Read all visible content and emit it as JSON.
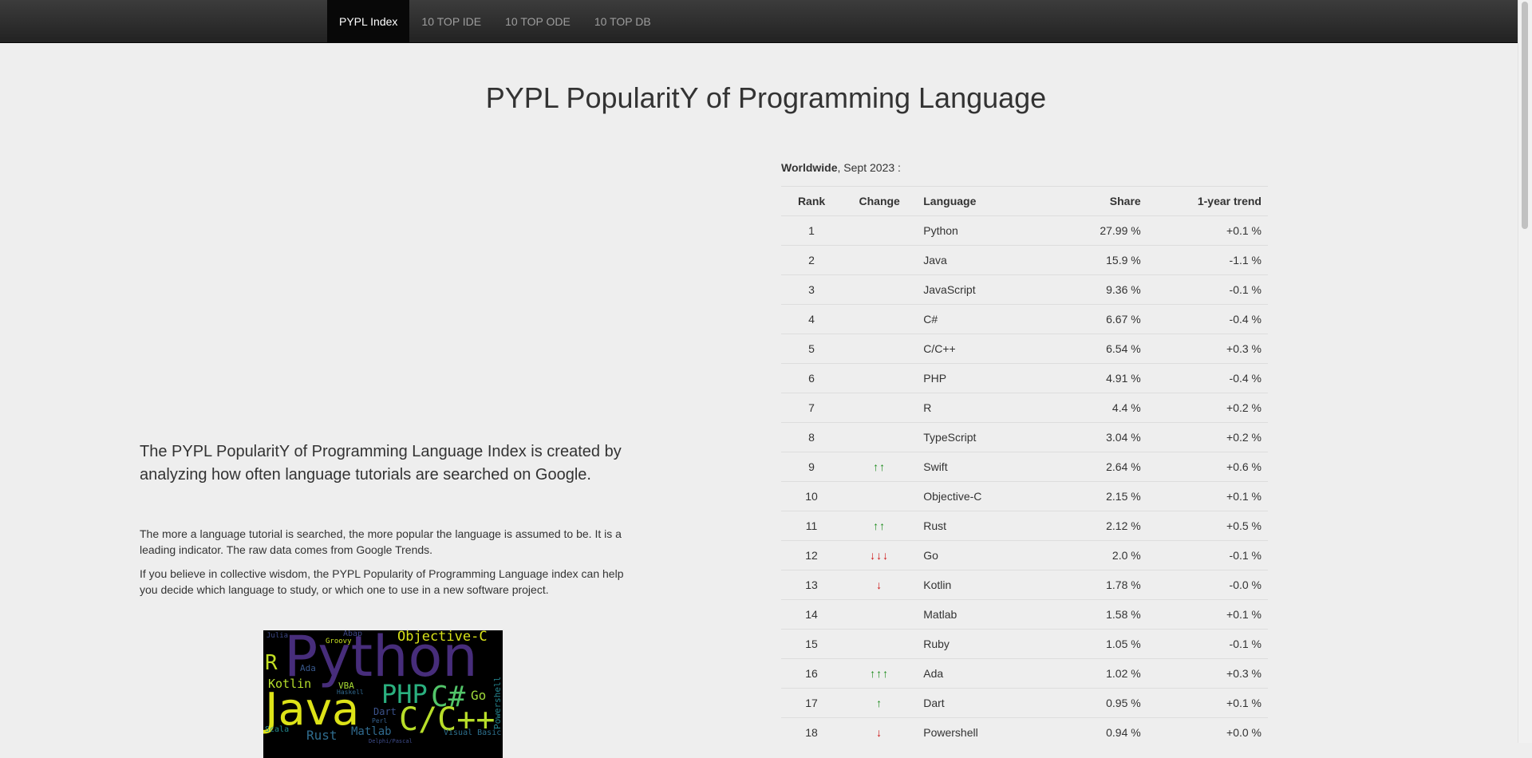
{
  "nav": {
    "items": [
      {
        "label": "PYPL Index",
        "active": true
      },
      {
        "label": "10 TOP IDE",
        "active": false
      },
      {
        "label": "10 TOP ODE",
        "active": false
      },
      {
        "label": "10 TOP DB",
        "active": false
      }
    ]
  },
  "page_title": "PYPL PopularitY of Programming Language",
  "intro": {
    "lead": "The PYPL PopularitY of Programming Language Index is created by analyzing how often language tutorials are searched on Google.",
    "paragraph_1": "The more a language tutorial is searched, the more popular the language is assumed to be. It is a leading indicator. The raw data comes from Google Trends.",
    "paragraph_2": "If you believe in collective wisdom, the PYPL Popularity of Programming Language index can help you decide which language to study, or which one to use in a new software project."
  },
  "word_cloud": {
    "words": [
      {
        "text": "Python",
        "color": "#472d7b"
      },
      {
        "text": "Java",
        "color": "#dde318"
      },
      {
        "text": "C/C++",
        "color": "#b8de29"
      },
      {
        "text": "PHP",
        "color": "#2ab07f"
      },
      {
        "text": "C#",
        "color": "#52c569"
      },
      {
        "text": "Objective-C",
        "color": "#d8e219"
      },
      {
        "text": "R",
        "color": "#c2df23"
      },
      {
        "text": "Kotlin",
        "color": "#b5de2b"
      },
      {
        "text": "Go",
        "color": "#9fda3a"
      },
      {
        "text": "Matlab",
        "color": "#306a8e"
      },
      {
        "text": "Rust",
        "color": "#2f6c8e"
      },
      {
        "text": "Dart",
        "color": "#3b528b"
      },
      {
        "text": "Ada",
        "color": "#38588c"
      },
      {
        "text": "VBA",
        "color": "#a8db34"
      },
      {
        "text": "Abap",
        "color": "#3f4889"
      },
      {
        "text": "Groovy",
        "color": "#c8e020"
      },
      {
        "text": "Julia",
        "color": "#3e4a89"
      },
      {
        "text": "Haskell",
        "color": "#31688e"
      },
      {
        "text": "Perl",
        "color": "#35608d"
      },
      {
        "text": "Scala",
        "color": "#23888e"
      },
      {
        "text": "Powershell",
        "color": "#25848e"
      },
      {
        "text": "Visual Basic",
        "color": "#2d708e"
      },
      {
        "text": "Delphi/Pascal",
        "color": "#3e4c8a"
      }
    ]
  },
  "ranking": {
    "region": "Worldwide",
    "date": ", Sept 2023 :",
    "headers": {
      "rank": "Rank",
      "change": "Change",
      "language": "Language",
      "share": "Share",
      "trend": "1-year trend"
    },
    "rows": [
      {
        "rank": "1",
        "change": "",
        "language": "Python",
        "share": "27.99 %",
        "trend": "+0.1 %"
      },
      {
        "rank": "2",
        "change": "",
        "language": "Java",
        "share": "15.9 %",
        "trend": "-1.1 %"
      },
      {
        "rank": "3",
        "change": "",
        "language": "JavaScript",
        "share": "9.36 %",
        "trend": "-0.1 %"
      },
      {
        "rank": "4",
        "change": "",
        "language": "C#",
        "share": "6.67 %",
        "trend": "-0.4 %"
      },
      {
        "rank": "5",
        "change": "",
        "language": "C/C++",
        "share": "6.54 %",
        "trend": "+0.3 %"
      },
      {
        "rank": "6",
        "change": "",
        "language": "PHP",
        "share": "4.91 %",
        "trend": "-0.4 %"
      },
      {
        "rank": "7",
        "change": "",
        "language": "R",
        "share": "4.4 %",
        "trend": "+0.2 %"
      },
      {
        "rank": "8",
        "change": "",
        "language": "TypeScript",
        "share": "3.04 %",
        "trend": "+0.2 %"
      },
      {
        "rank": "9",
        "change": "up-2",
        "language": "Swift",
        "share": "2.64 %",
        "trend": "+0.6 %"
      },
      {
        "rank": "10",
        "change": "",
        "language": "Objective-C",
        "share": "2.15 %",
        "trend": "+0.1 %"
      },
      {
        "rank": "11",
        "change": "up-2",
        "language": "Rust",
        "share": "2.12 %",
        "trend": "+0.5 %"
      },
      {
        "rank": "12",
        "change": "down-3",
        "language": "Go",
        "share": "2.0 %",
        "trend": "-0.1 %"
      },
      {
        "rank": "13",
        "change": "down-1",
        "language": "Kotlin",
        "share": "1.78 %",
        "trend": "-0.0 %"
      },
      {
        "rank": "14",
        "change": "",
        "language": "Matlab",
        "share": "1.58 %",
        "trend": "+0.1 %"
      },
      {
        "rank": "15",
        "change": "",
        "language": "Ruby",
        "share": "1.05 %",
        "trend": "-0.1 %"
      },
      {
        "rank": "16",
        "change": "up-3",
        "language": "Ada",
        "share": "1.02 %",
        "trend": "+0.3 %"
      },
      {
        "rank": "17",
        "change": "up-1",
        "language": "Dart",
        "share": "0.95 %",
        "trend": "+0.1 %"
      },
      {
        "rank": "18",
        "change": "down-1",
        "language": "Powershell",
        "share": "0.94 %",
        "trend": "+0.0 %"
      }
    ]
  },
  "colors": {
    "navbar_bg": "#222222",
    "nav_active_bg": "#080808",
    "page_bg": "#eeeeee",
    "arrow_up": "#1a8a1a",
    "arrow_down": "#cc1111"
  }
}
